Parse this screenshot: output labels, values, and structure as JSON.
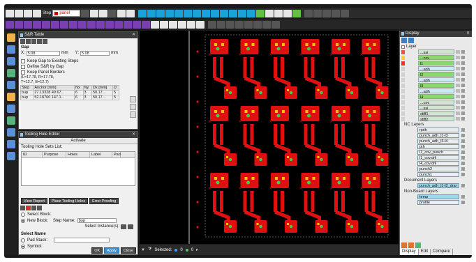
{
  "toolbar": {
    "step_label": "Step",
    "step_value": "panel"
  },
  "sr_table": {
    "title": "S&R Table",
    "gap_label": "Gap",
    "x_label": "X:",
    "x_value": "5.08",
    "x_unit": "mm",
    "y_label": "Y:",
    "y_value": "5.08",
    "y_unit": "mm",
    "options": [
      "Keep Gap to Existing Steps",
      "Define S&R by Gap",
      "Keep Panel Borders"
    ],
    "note1": "(L=17.78, R=17.78,",
    "note2": "T=12.7, B=12.7)",
    "columns": [
      "Step",
      "Anchor [mm]",
      "Nx",
      "Ny",
      "Dx [mm]",
      "D"
    ],
    "rows": [
      [
        "bup",
        "27.13328",
        "49.67...",
        "6",
        "3",
        "50.17...",
        "5"
      ],
      [
        "bup",
        "52.18760",
        "147.1...",
        "6",
        "3",
        "50.17...",
        "5"
      ]
    ]
  },
  "tooling": {
    "title": "Tooling Hole Editor",
    "activate": "Activate",
    "sets_label": "Tooling Hole Sets List:",
    "columns": [
      "ID",
      "Purpose",
      "Holes",
      "Label",
      "Pad"
    ],
    "buttons": [
      "View Report",
      "Place Tooling Holes",
      "Error Proofing"
    ],
    "select_block": "Select Block:",
    "new_block": "New Block:",
    "step_name_label": "Step Name:",
    "step_name_value": "bup",
    "select_instances": "Select Instance(s):",
    "select_name": "Select Name",
    "pad_stack": "Pad Stack:",
    "symbol": "Symbol:",
    "ok": "OK",
    "apply": "Apply",
    "close": "Close"
  },
  "status": {
    "selected_label": "Selected:",
    "selected_count": "0",
    "second_count": "0"
  },
  "display": {
    "title": "Display",
    "layer_header": "Layer",
    "board_layers": [
      {
        "name": "...ssi",
        "color": "#ff4a4a",
        "fill": "#cfe5cf"
      },
      {
        "name": "...cov",
        "color": "#ffcf3a",
        "fill": "#8fd66e"
      },
      {
        "name": "l1",
        "color": "#ff2a2a",
        "fill": "#8fd66e"
      },
      {
        "name": "...adh",
        "color": "#d0d0d0",
        "fill": "#cfe9f2"
      },
      {
        "name": "l2",
        "color": "#d0d0d0",
        "fill": "#8fd66e"
      },
      {
        "name": "...adh",
        "color": "#d0d0d0",
        "fill": "#cfe9f2"
      },
      {
        "name": "l3",
        "color": "#d0d0d0",
        "fill": "#8fd66e"
      },
      {
        "name": "...adh",
        "color": "#d0d0d0",
        "fill": "#cfe9f2"
      },
      {
        "name": "l4",
        "color": "#d0d0d0",
        "fill": "#8fd66e"
      },
      {
        "name": "...cov",
        "color": "#d0d0d0",
        "fill": "#cfe5cf"
      },
      {
        "name": "...ssi",
        "color": "#d0d0d0",
        "fill": "#cfe5cf"
      },
      {
        "name": "stiff1",
        "color": "#d0d0d0",
        "fill": "#cfe5cf"
      },
      {
        "name": "stiff2",
        "color": "#d0d0d0",
        "fill": "#cfe5cf"
      }
    ],
    "nc_header": "NC Layers",
    "nc_layers": [
      "npth",
      "punch_adh_l1-l3",
      "punch_adh_l3-l4",
      "pth",
      "l1_cov_punch",
      "l1_cov.dril",
      "l4_cov.dril",
      "punch2",
      "punch1"
    ],
    "doc_header": "Document Layers",
    "doc_layers": [
      "punch_adh_l1-l2_drar"
    ],
    "nonboard_header": "Non-Board Layers",
    "nonboard_layers": [
      "temp",
      "profile"
    ],
    "tabs": [
      "Display",
      "Edit",
      "Compare"
    ]
  }
}
